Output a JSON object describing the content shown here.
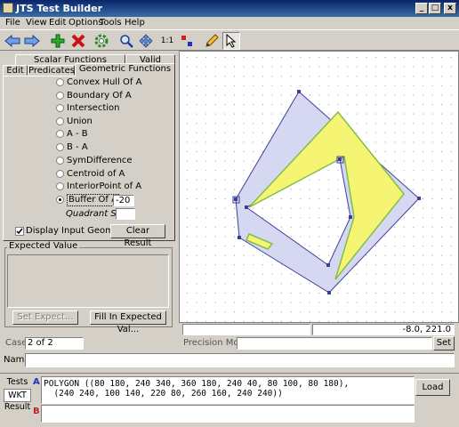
{
  "window": {
    "title": "JTS Test Builder",
    "min_label": "_",
    "max_label": "□",
    "close_label": "x"
  },
  "menu": [
    "File",
    "View",
    "Edit",
    "Options",
    "Tools",
    "Help"
  ],
  "toolbar": {
    "icons": [
      "previous-arrow-icon",
      "next-arrow-icon",
      "add-case-icon",
      "delete-case-icon",
      "settings-gear-icon",
      "zoom-icon",
      "pan-icon",
      "one-to-one-label",
      "grid-points-icon",
      "draw-pencil-icon",
      "select-pointer-icon"
    ],
    "one_to_one": "1:1"
  },
  "tabs": {
    "back_row": [
      "Scalar Functions",
      "Valid"
    ],
    "front_row": [
      "Edit",
      "Predicates",
      "Geometric Functions"
    ],
    "active": "Geometric Functions"
  },
  "functions": [
    {
      "label": "Convex Hull Of A",
      "selected": false
    },
    {
      "label": "Boundary Of A",
      "selected": false
    },
    {
      "label": "Intersection",
      "selected": false
    },
    {
      "label": "Union",
      "selected": false
    },
    {
      "label": "A - B",
      "selected": false
    },
    {
      "label": "B - A",
      "selected": false
    },
    {
      "label": "SymDifference",
      "selected": false
    },
    {
      "label": "Centroid of A",
      "selected": false
    },
    {
      "label": "InteriorPoint of A",
      "selected": false
    },
    {
      "label": "Buffer Of A",
      "selected": true
    }
  ],
  "buffer_value": "-20",
  "quadrant_segs": {
    "label": "Quadrant Segs",
    "value": ""
  },
  "display_input": {
    "label": "Display Input Geometries",
    "checked": true
  },
  "clear_result": "Clear Result",
  "expected": {
    "label": "Expected Value",
    "set_expect": "Set Expect...",
    "fill_expected": "Fill In Expected Val..."
  },
  "coords": "-8.0, 221.0",
  "case": {
    "label": "Case",
    "value": "2 of 2"
  },
  "precision": {
    "label": "Precision Model",
    "set": "Set"
  },
  "name": {
    "label": "Name",
    "value": ""
  },
  "bottom_tabs": [
    "Tests",
    "WKT",
    "Result"
  ],
  "geom_labels": {
    "a": "A",
    "b": "B"
  },
  "wkt_a": "POLYGON ((80 180, 240 340, 360 180, 240 40, 80 100, 80 180),\n  (240 240, 100 140, 220 80, 260 160, 240 240))",
  "wkt_b": "",
  "load": "Load",
  "colors": {
    "titlebar": "#0a246a",
    "geometry_fill": "#d6d8f2",
    "result_fill": "#f5f573",
    "result_edge": "#7fc04a",
    "vertex": "#3e3e9a"
  }
}
